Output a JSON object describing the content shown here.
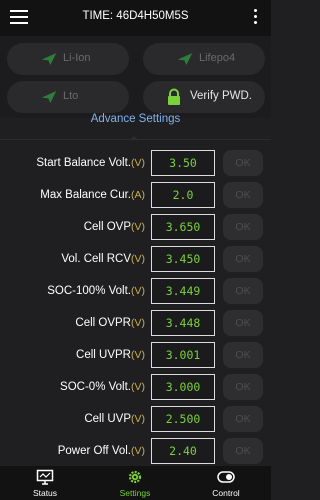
{
  "header": {
    "title": "TIME: 46D4H50M5S",
    "menu_icon": "hamburger-menu-icon",
    "more_icon": "kebab-more-icon"
  },
  "chemistry_buttons": [
    {
      "label": "Li-Ion",
      "icon": "send-icon"
    },
    {
      "label": "Lifepo4",
      "icon": "send-icon"
    },
    {
      "label": "Lto",
      "icon": "send-icon"
    }
  ],
  "verify": {
    "label": "Verify PWD.",
    "icon": "lock-icon",
    "color": "#7ad13a"
  },
  "section_title": "Advance Settings",
  "settings": [
    {
      "label": "Start Balance Volt.",
      "unit": "(V)",
      "value": "3.50",
      "ok": "OK"
    },
    {
      "label": "Max Balance Cur.",
      "unit": "(A)",
      "value": "2.0",
      "ok": "OK"
    },
    {
      "label": "Cell OVP",
      "unit": "(V)",
      "value": "3.650",
      "ok": "OK"
    },
    {
      "label": "Vol. Cell RCV",
      "unit": "(V)",
      "value": "3.450",
      "ok": "OK"
    },
    {
      "label": "SOC-100% Volt.",
      "unit": "(V)",
      "value": "3.449",
      "ok": "OK"
    },
    {
      "label": "Cell OVPR",
      "unit": "(V)",
      "value": "3.448",
      "ok": "OK"
    },
    {
      "label": "Cell UVPR",
      "unit": "(V)",
      "value": "3.001",
      "ok": "OK"
    },
    {
      "label": "SOC-0% Volt.",
      "unit": "(V)",
      "value": "3.000",
      "ok": "OK"
    },
    {
      "label": "Cell UVP",
      "unit": "(V)",
      "value": "2.500",
      "ok": "OK"
    },
    {
      "label": "Power Off Vol.",
      "unit": "(V)",
      "value": "2.40",
      "ok": "OK"
    }
  ],
  "bottom_nav": [
    {
      "label": "Status",
      "icon": "monitor-icon",
      "active": false
    },
    {
      "label": "Settings",
      "icon": "gear-icon",
      "active": true
    },
    {
      "label": "Control",
      "icon": "toggle-icon",
      "active": false
    }
  ],
  "colors": {
    "accent_green": "#7ad13a",
    "section_blue": "#7fb2ee",
    "unit_yellow": "#c9b04d"
  }
}
